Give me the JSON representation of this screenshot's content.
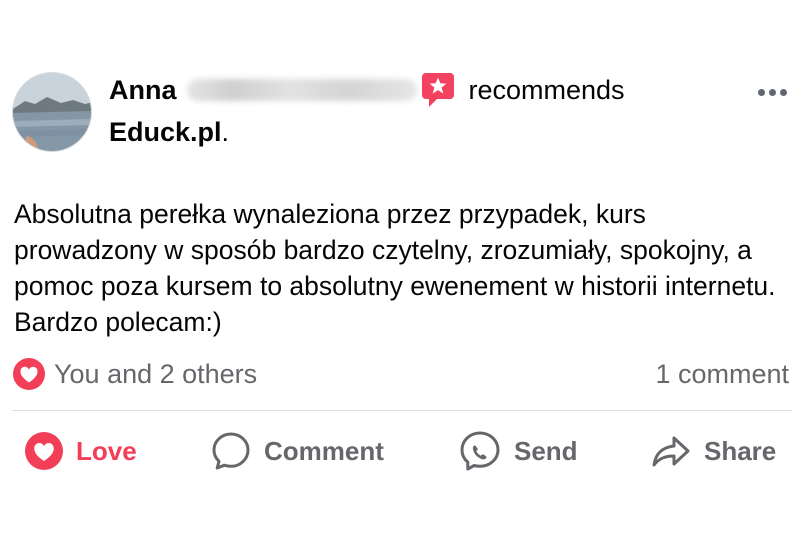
{
  "post": {
    "author_first_name": "Anna",
    "author_last_name_redacted": true,
    "action_text": "recommends",
    "page_name": "Educk.pl",
    "page_suffix": ".",
    "body": "Absolutna perełka wynaleziona przez przypadek, kurs prowadzony w sposób bardzo czytelny, zrozumiały, spokojny, a pomoc poza kursem to absolutny ewenement w historii internetu. Bardzo polecam:)",
    "icons": {
      "avatar": "profile-photo",
      "recommend": "recommend-star-icon",
      "more": "more-options-icon"
    }
  },
  "engagement": {
    "reaction_icon": "love-reaction-icon",
    "reactions_text": "You and 2 others",
    "comments_text": "1 comment"
  },
  "actions": {
    "love": {
      "label": "Love",
      "icon": "love-icon",
      "active": true
    },
    "comment": {
      "label": "Comment",
      "icon": "comment-bubble-icon"
    },
    "send": {
      "label": "Send",
      "icon": "messenger-icon"
    },
    "share": {
      "label": "Share",
      "icon": "share-arrow-icon"
    }
  },
  "colors": {
    "love_red": "#f33e58",
    "recommend_pink": "#f3425f",
    "secondary_text": "#65676b",
    "primary_text": "#050505",
    "divider": "#dadde1"
  }
}
